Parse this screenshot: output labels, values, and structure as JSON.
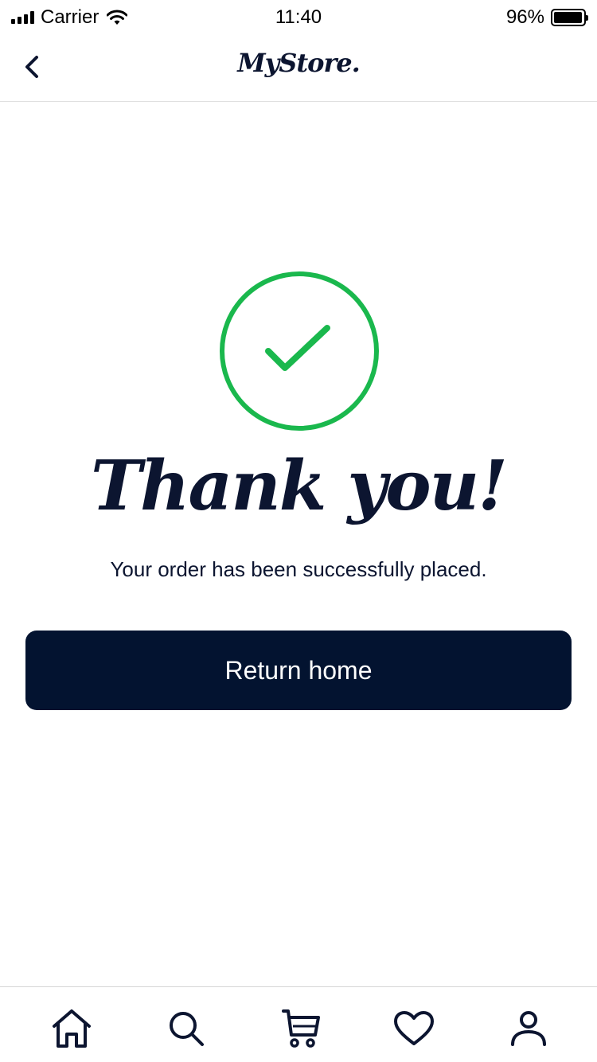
{
  "status_bar": {
    "carrier": "Carrier",
    "time": "11:40",
    "battery": "96%",
    "battery_level": 0.96
  },
  "nav": {
    "logo": "MyStore.",
    "back_icon": "chevron-left-icon"
  },
  "content": {
    "title": "Thank you!",
    "subtitle": "Your order has been successfully placed.",
    "button_label": "Return home",
    "success_icon": "checkmark-circle-icon"
  },
  "tab_bar": {
    "items": [
      {
        "icon": "home-icon"
      },
      {
        "icon": "search-icon"
      },
      {
        "icon": "cart-icon"
      },
      {
        "icon": "heart-icon"
      },
      {
        "icon": "user-icon"
      }
    ]
  },
  "colors": {
    "primary": "#031330",
    "success": "#1ab84d",
    "text": "#0c1530"
  }
}
